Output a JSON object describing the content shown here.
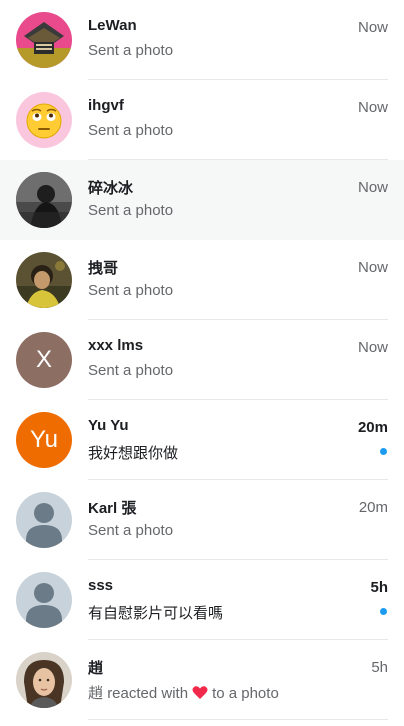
{
  "threads": [
    {
      "name": "LeWan",
      "preview": "Sent a photo",
      "time": "Now",
      "unread": false
    },
    {
      "name": "ihgvf",
      "preview": "Sent a photo",
      "time": "Now",
      "unread": false
    },
    {
      "name": "碎冰冰",
      "preview": "Sent a photo",
      "time": "Now",
      "unread": false
    },
    {
      "name": "拽哥",
      "preview": "Sent a photo",
      "time": "Now",
      "unread": false
    },
    {
      "name": "xxx lms",
      "avatar_letter": "X",
      "avatar_color": "#8d6e63",
      "preview": "Sent a photo",
      "time": "Now",
      "unread": false
    },
    {
      "name": "Yu Yu",
      "avatar_letter": "Yu",
      "avatar_color": "#ef6c00",
      "preview": "我好想跟你做",
      "time": "20m",
      "unread": true
    },
    {
      "name": "Karl 張",
      "preview": "Sent a photo",
      "time": "20m",
      "unread": false
    },
    {
      "name": "sss",
      "preview": "有自慰影片可以看嗎",
      "time": "5h",
      "unread": true
    },
    {
      "name": "趙",
      "preview_sender": "趙",
      "preview_action": "reacted with",
      "preview_suffix": "to a photo",
      "time": "5h",
      "unread": false
    }
  ],
  "colors": {
    "unread_dot": "#1d9bf0",
    "heart": "#f02849",
    "selected_row": "#f6f7f7"
  }
}
